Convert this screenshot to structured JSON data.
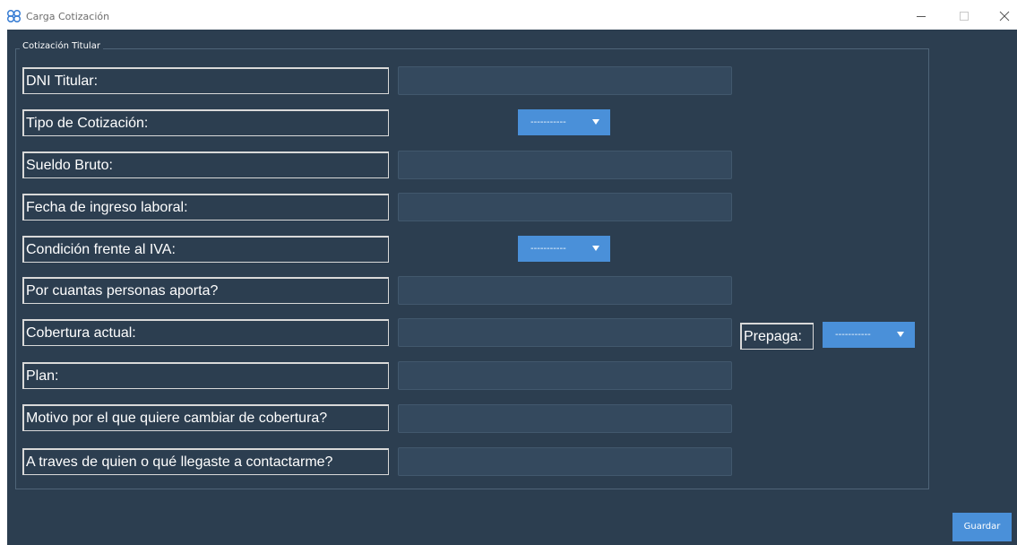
{
  "window": {
    "title": "Carga Cotización"
  },
  "group": {
    "title": "Cotización Titular"
  },
  "fields": [
    {
      "label": "DNI Titular:",
      "value": "",
      "control": "input"
    },
    {
      "label": "Tipo de Cotización:",
      "value": "-----------",
      "control": "combo"
    },
    {
      "label": "Sueldo Bruto:",
      "value": "",
      "control": "input"
    },
    {
      "label": "Fecha de ingreso laboral:",
      "value": "",
      "control": "input"
    },
    {
      "label": "Condición frente al IVA:",
      "value": "-----------",
      "control": "combo"
    },
    {
      "label": "Por cuantas personas aporta?",
      "value": "",
      "control": "input"
    },
    {
      "label": "Cobertura actual:",
      "value": "",
      "control": "input"
    },
    {
      "label": "Plan:",
      "value": "",
      "control": "input"
    },
    {
      "label": "Motivo por el que quiere cambiar de cobertura?",
      "value": "",
      "control": "input"
    },
    {
      "label": "A traves de quien o qué llegaste a contactarme?",
      "value": "",
      "control": "input"
    }
  ],
  "prepaga": {
    "label": "Prepaga:",
    "value": "-----------"
  },
  "actions": {
    "save_label": "Guardar"
  },
  "colors": {
    "background": "#2c3e50",
    "input_bg": "#34495e",
    "accent": "#4a90d9",
    "text": "#ffffff"
  }
}
